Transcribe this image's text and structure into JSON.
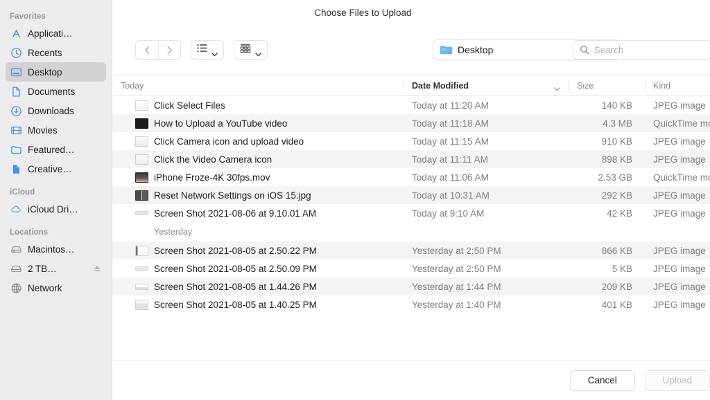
{
  "window": {
    "title": "Choose Files to Upload"
  },
  "sidebar": {
    "sections": [
      {
        "label": "Favorites",
        "items": [
          {
            "label": "Applicati…",
            "icon": "applications-icon",
            "selected": false
          },
          {
            "label": "Recents",
            "icon": "clock-icon",
            "selected": false
          },
          {
            "label": "Desktop",
            "icon": "desktop-icon",
            "selected": true
          },
          {
            "label": "Documents",
            "icon": "document-icon",
            "selected": false
          },
          {
            "label": "Downloads",
            "icon": "download-icon",
            "selected": false
          },
          {
            "label": "Movies",
            "icon": "film-icon",
            "selected": false
          },
          {
            "label": "Featured…",
            "icon": "folder-icon",
            "selected": false
          },
          {
            "label": "Creative…",
            "icon": "document-filled-icon",
            "selected": false
          }
        ]
      },
      {
        "label": "iCloud",
        "items": [
          {
            "label": "iCloud Dri…",
            "icon": "cloud-icon",
            "selected": false
          }
        ]
      },
      {
        "label": "Locations",
        "items": [
          {
            "label": "Macintos…",
            "icon": "harddisk-icon",
            "selected": false
          },
          {
            "label": "2 TB…",
            "icon": "harddisk-icon",
            "selected": false,
            "eject": true
          },
          {
            "label": "Network",
            "icon": "globe-icon",
            "selected": false
          }
        ]
      }
    ]
  },
  "toolbar": {
    "back_label": "Back",
    "forward_label": "Forward",
    "view_mode_label": "List view",
    "group_mode_label": "Group by",
    "path": {
      "label": "Desktop",
      "icon": "folder-icon"
    },
    "search": {
      "placeholder": "Search",
      "value": "",
      "icon": "search-icon"
    }
  },
  "columns": [
    {
      "key": "name",
      "label": "Today",
      "sorted": false
    },
    {
      "key": "date",
      "label": "Date Modified",
      "sorted": true
    },
    {
      "key": "size",
      "label": "Size",
      "sorted": false
    },
    {
      "key": "kind",
      "label": "Kind",
      "sorted": false
    }
  ],
  "groups": [
    {
      "label": "Today",
      "inline_header": true,
      "rows": [
        {
          "name": "Click Select Files",
          "date": "Today at 11:20 AM",
          "size": "140 KB",
          "kind": "JPEG image",
          "thumb": "screenshot-light"
        },
        {
          "name": "How to Upload a YouTube video",
          "date": "Today at 11:18 AM",
          "size": "4.3 MB",
          "kind": "QuickTime movie",
          "thumb": "video-dark"
        },
        {
          "name": "Click Camera icon and upload video",
          "date": "Today at 11:15 AM",
          "size": "910 KB",
          "kind": "JPEG image",
          "thumb": "screenshot-text"
        },
        {
          "name": "Click the Video Camera icon",
          "date": "Today at 11:11 AM",
          "size": "898 KB",
          "kind": "JPEG image",
          "thumb": "screenshot-text"
        },
        {
          "name": "iPhone Froze-4K 30fps.mov",
          "date": "Today at 11:06 AM",
          "size": "2.53 GB",
          "kind": "QuickTime movie",
          "thumb": "photo-dark"
        },
        {
          "name": "Reset Network Settings on iOS 15.jpg",
          "date": "Today at 10:31 AM",
          "size": "292 KB",
          "kind": "JPEG image",
          "thumb": "phone-pair"
        },
        {
          "name": "Screen Shot 2021-08-06 at 9.10.01 AM",
          "date": "Today at 9:10 AM",
          "size": "42 KB",
          "kind": "JPEG image",
          "thumb": "strip"
        }
      ]
    },
    {
      "label": "Yesterday",
      "inline_header": false,
      "rows": [
        {
          "name": "Screen Shot 2021-08-05 at 2.50.22 PM",
          "date": "Yesterday at 2:50 PM",
          "size": "866 KB",
          "kind": "JPEG image",
          "thumb": "screenshot-box"
        },
        {
          "name": "Screen Shot 2021-08-05 at 2.50.09 PM",
          "date": "Yesterday at 2:50 PM",
          "size": "5 KB",
          "kind": "JPEG image",
          "thumb": "strip"
        },
        {
          "name": "Screen Shot 2021-08-05 at 1.44.26 PM",
          "date": "Yesterday at 1:44 PM",
          "size": "209 KB",
          "kind": "JPEG image",
          "thumb": "strip2"
        },
        {
          "name": "Screen Shot 2021-08-05 at 1.40.25 PM",
          "date": "Yesterday at 1:40 PM",
          "size": "401 KB",
          "kind": "JPEG image",
          "thumb": "screenshot-text"
        }
      ]
    }
  ],
  "footer": {
    "cancel_label": "Cancel",
    "upload_label": "Upload",
    "upload_enabled": false
  },
  "colors": {
    "accent": "#3a86f7",
    "sidebar_bg": "#ececec",
    "selected_row": "#d2d2d2",
    "stripe": "#f4f4f4"
  }
}
